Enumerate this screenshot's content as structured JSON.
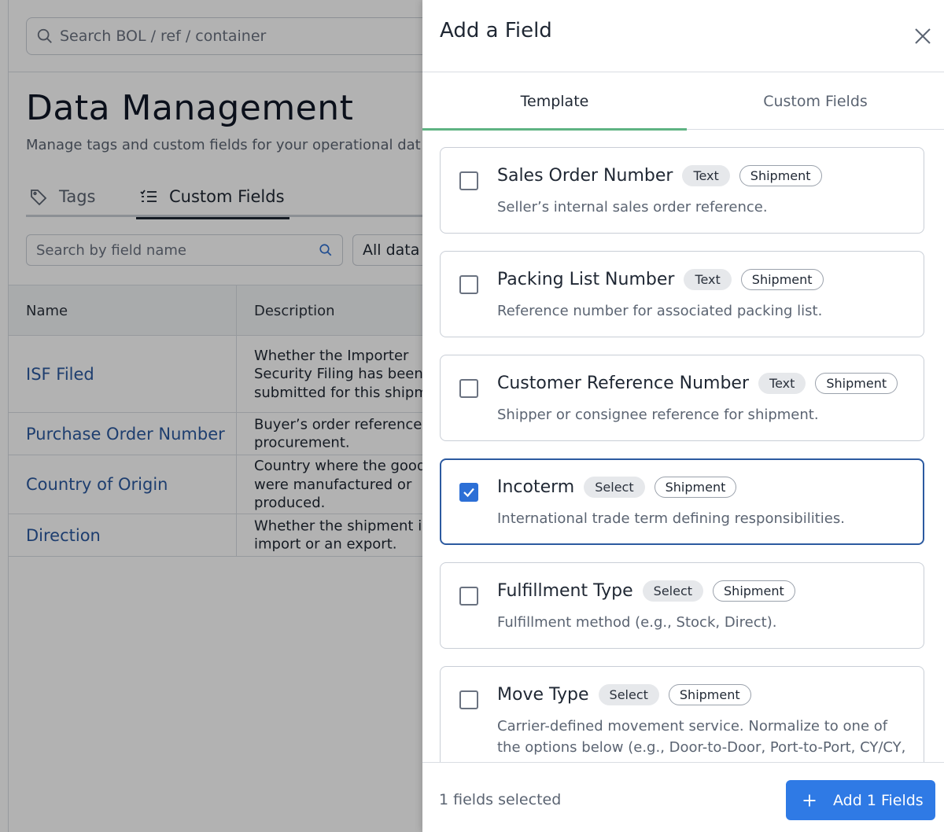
{
  "background": {
    "global_search_placeholder": "Search BOL / ref / container",
    "page_title": "Data Management",
    "page_subtitle": "Manage tags and custom fields for your operational dat",
    "tabs": [
      {
        "label": "Tags"
      },
      {
        "label": "Custom Fields"
      }
    ],
    "field_search_placeholder": "Search by field name",
    "data_filter_label": "All data",
    "table": {
      "headers": {
        "name": "Name",
        "description": "Description"
      },
      "rows": [
        {
          "name": "ISF Filed",
          "description": "Whether the Importer Security Filing has been submitted for this shipment."
        },
        {
          "name": "Purchase Order Number",
          "description": "Buyer’s order reference f procurement."
        },
        {
          "name": "Country of Origin",
          "description": "Country where the good were manufactured or produced."
        },
        {
          "name": "Direction",
          "description": "Whether the shipment is an import or an export."
        }
      ]
    }
  },
  "drawer": {
    "title": "Add a Field",
    "tabs": [
      {
        "label": "Template",
        "active": true
      },
      {
        "label": "Custom Fields",
        "active": false
      }
    ],
    "fields": [
      {
        "title": "Sales Order Number",
        "type": "Text",
        "scope": "Shipment",
        "description": "Seller’s internal sales order reference.",
        "checked": false
      },
      {
        "title": "Packing List Number",
        "type": "Text",
        "scope": "Shipment",
        "description": "Reference number for associated packing list.",
        "checked": false
      },
      {
        "title": "Customer Reference Number",
        "type": "Text",
        "scope": "Shipment",
        "description": "Shipper or consignee reference for shipment.",
        "checked": false
      },
      {
        "title": "Incoterm",
        "type": "Select",
        "scope": "Shipment",
        "description": "International trade term defining responsibilities.",
        "checked": true
      },
      {
        "title": "Fulfillment Type",
        "type": "Select",
        "scope": "Shipment",
        "description": "Fulfillment method (e.g., Stock, Direct).",
        "checked": false
      },
      {
        "title": "Move Type",
        "type": "Select",
        "scope": "Shipment",
        "description": "Carrier-defined movement service. Normalize to one of the options below (e.g., Door-to-Door, Port-to-Port, CY/CY, CFS/CY). Used for planning, costing, and",
        "checked": false
      }
    ],
    "footer": {
      "selected_text": "1 fields selected",
      "add_button_label": "Add 1 Fields"
    }
  },
  "icons": {
    "search": "search-icon",
    "tag": "tag-icon",
    "list": "checklist-icon",
    "close": "close-icon",
    "check": "check-icon",
    "plus": "plus-icon"
  },
  "colors": {
    "primary_button": "#2f7ae5",
    "selected_border": "#2c5aa0",
    "active_tab_underline": "#5fb383",
    "link": "#2c5aa0"
  }
}
